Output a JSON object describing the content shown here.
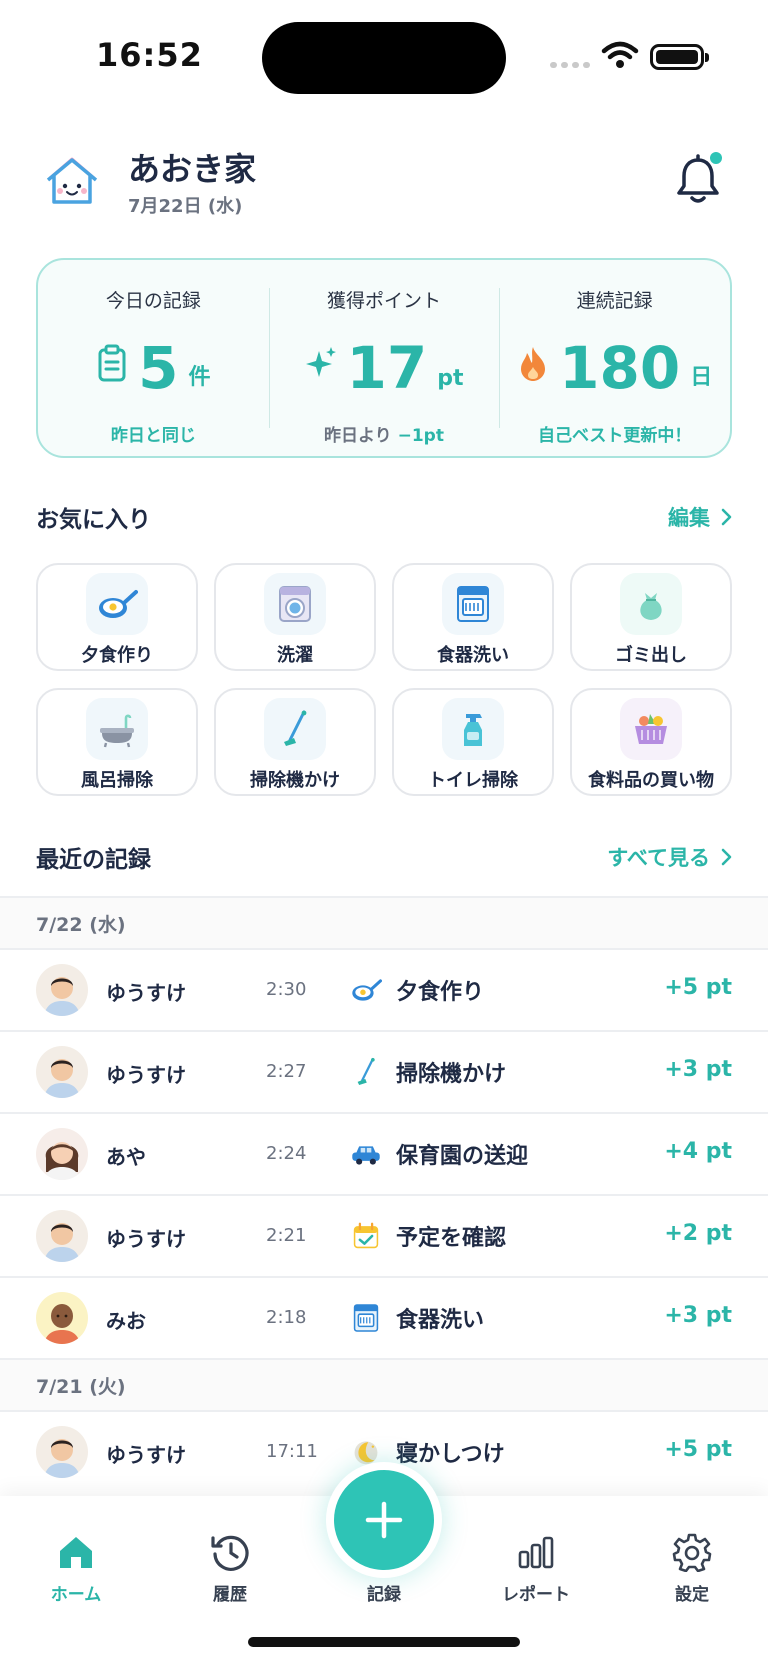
{
  "status_bar": {
    "time": "16:52"
  },
  "header": {
    "family_name": "あおき家",
    "date": "7月22日 (水)"
  },
  "stats": [
    {
      "label": "今日の記録",
      "value": "5",
      "unit": "件",
      "note": "昨日と同じ",
      "icon": "clipboard-icon"
    },
    {
      "label": "獲得ポイント",
      "value": "17",
      "unit": "pt",
      "note_prefix": "昨日より",
      "note_value": "−1pt",
      "icon": "sparkle-icon"
    },
    {
      "label": "連続記録",
      "value": "180",
      "unit": "日",
      "note": "自己ベスト更新中！",
      "icon": "flame-icon"
    }
  ],
  "favorites": {
    "title": "お気に入り",
    "edit_label": "編集",
    "items": [
      {
        "label": "夕食作り",
        "icon": "frying-pan-icon"
      },
      {
        "label": "洗濯",
        "icon": "washing-machine-icon"
      },
      {
        "label": "食器洗い",
        "icon": "dishwasher-icon"
      },
      {
        "label": "ゴミ出し",
        "icon": "trash-bag-icon"
      },
      {
        "label": "風呂掃除",
        "icon": "bathtub-icon"
      },
      {
        "label": "掃除機かけ",
        "icon": "vacuum-icon"
      },
      {
        "label": "トイレ掃除",
        "icon": "spray-bottle-icon"
      },
      {
        "label": "食料品の買い物",
        "icon": "shopping-basket-icon"
      }
    ]
  },
  "recent": {
    "title": "最近の記録",
    "see_all_label": "すべて見る",
    "groups": [
      {
        "date": "7/22 (水)",
        "rows": [
          {
            "user": "ゆうすけ",
            "time": "2:30",
            "task": "夕食作り",
            "points": "+5 pt",
            "icon": "frying-pan-icon"
          },
          {
            "user": "ゆうすけ",
            "time": "2:27",
            "task": "掃除機かけ",
            "points": "+3 pt",
            "icon": "vacuum-icon"
          },
          {
            "user": "あや",
            "time": "2:24",
            "task": "保育園の送迎",
            "points": "+4 pt",
            "icon": "car-icon"
          },
          {
            "user": "ゆうすけ",
            "time": "2:21",
            "task": "予定を確認",
            "points": "+2 pt",
            "icon": "calendar-check-icon"
          },
          {
            "user": "みお",
            "time": "2:18",
            "task": "食器洗い",
            "points": "+3 pt",
            "icon": "dishwasher-icon"
          }
        ]
      },
      {
        "date": "7/21 (火)",
        "rows": [
          {
            "user": "ゆうすけ",
            "time": "17:11",
            "task": "寝かしつけ",
            "points": "+5 pt",
            "icon": "moon-icon"
          }
        ]
      }
    ]
  },
  "nav": {
    "home": "ホーム",
    "history": "履歴",
    "record": "記録",
    "report": "レポート",
    "settings": "設定"
  },
  "colors": {
    "accent": "#2bb5a8",
    "fab": "#2ec4b6",
    "text": "#1f2a44"
  }
}
